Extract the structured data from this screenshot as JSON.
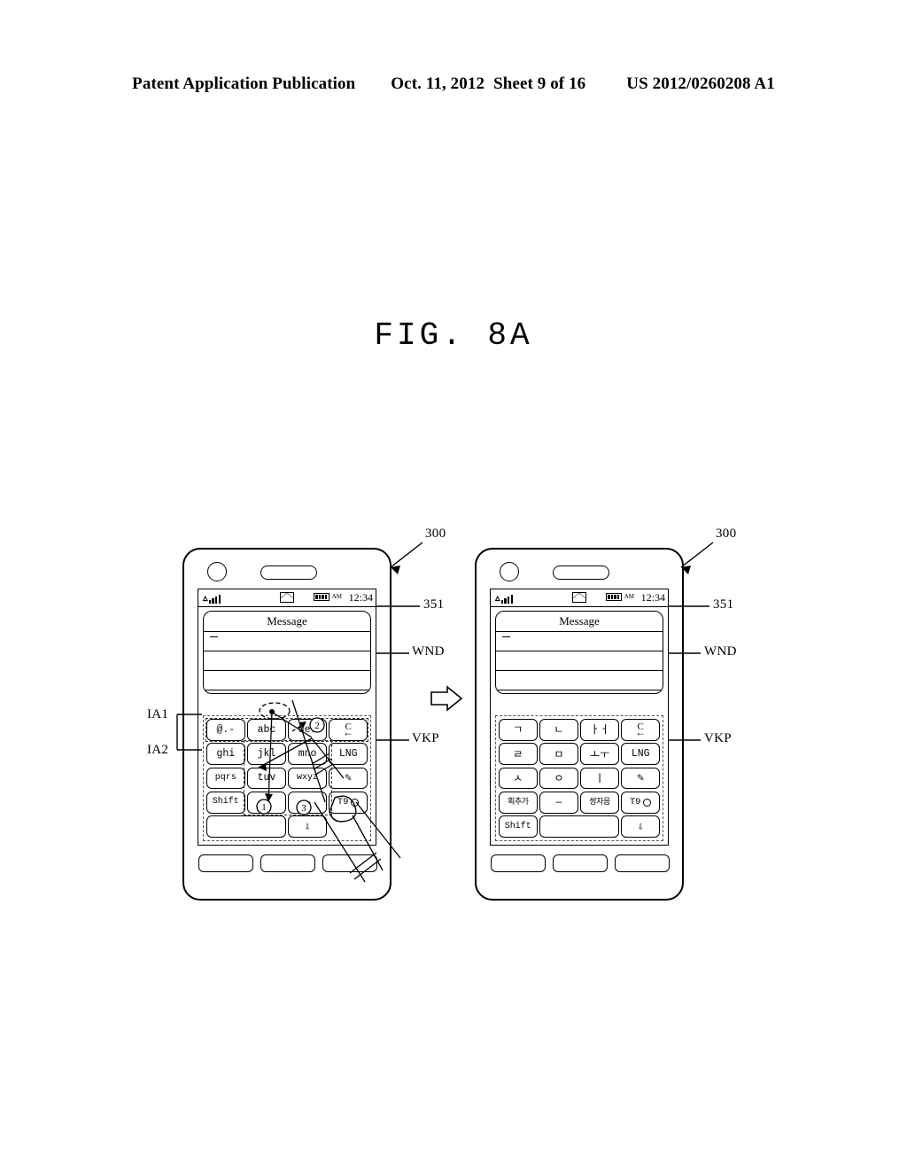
{
  "header": {
    "publication": "Patent Application Publication",
    "date": "Oct. 11, 2012",
    "sheet": "Sheet 9 of 16",
    "number": "US 2012/0260208 A1"
  },
  "figure": {
    "title": "FIG.  8A"
  },
  "status_bar": {
    "signal_icon": "signal-bars-icon",
    "message_icon": "envelope-icon",
    "battery_icon": "battery-icon",
    "ampm": "AM",
    "time": "12:34"
  },
  "message_window": {
    "title": "Message",
    "body_marker": "-"
  },
  "phones": {
    "left": {
      "keypad_mode": "latin",
      "keys": [
        {
          "label": "@.-",
          "name": "key-symbols"
        },
        {
          "label": "abc",
          "name": "key-abc"
        },
        {
          "label": "def",
          "name": "key-def"
        },
        {
          "label": "C",
          "name": "key-clear",
          "icon": "clear-backspace-icon"
        },
        {
          "label": "ghi",
          "name": "key-ghi"
        },
        {
          "label": "jkl",
          "name": "key-jkl"
        },
        {
          "label": "mno",
          "name": "key-mno"
        },
        {
          "label": "LNG",
          "name": "key-language"
        },
        {
          "label": "pqrs",
          "name": "key-pqrs"
        },
        {
          "label": "tuv",
          "name": "key-tuv"
        },
        {
          "label": "wxyz",
          "name": "key-wxyz"
        },
        {
          "label": "",
          "name": "key-handwriting",
          "icon": "pencil-icon"
        },
        {
          "label": "Shift",
          "name": "key-shift"
        },
        {
          "label": "",
          "name": "key-asterisk"
        },
        {
          "label": "—",
          "name": "key-dash"
        },
        {
          "label": "T9",
          "name": "key-t9",
          "icon": "t9-toggle-icon"
        },
        {
          "label": "",
          "name": "key-space",
          "wide": true
        },
        {
          "label": "",
          "name": "key-enter",
          "icon": "enter-download-icon"
        }
      ]
    },
    "right": {
      "keypad_mode": "korean",
      "keys": [
        {
          "label": "ㄱ",
          "name": "key-giyeok"
        },
        {
          "label": "ㄴ",
          "name": "key-nieun"
        },
        {
          "label": "ㅏㅓ",
          "name": "key-a-eo"
        },
        {
          "label": "C",
          "name": "key-clear",
          "icon": "clear-backspace-icon"
        },
        {
          "label": "ㄹ",
          "name": "key-rieul"
        },
        {
          "label": "ㅁ",
          "name": "key-mieum"
        },
        {
          "label": "ㅗㅜ",
          "name": "key-o-u"
        },
        {
          "label": "LNG",
          "name": "key-language"
        },
        {
          "label": "ㅅ",
          "name": "key-siot"
        },
        {
          "label": "ㅇ",
          "name": "key-ieung"
        },
        {
          "label": "ㅣ",
          "name": "key-i"
        },
        {
          "label": "",
          "name": "key-handwriting",
          "icon": "pencil-icon"
        },
        {
          "label": "획추가",
          "name": "key-add-stroke"
        },
        {
          "label": "—",
          "name": "key-dash"
        },
        {
          "label": "쌍자음",
          "name": "key-double-consonant"
        },
        {
          "label": "T9",
          "name": "key-t9",
          "icon": "t9-toggle-icon"
        },
        {
          "label": "Shift",
          "name": "key-shift"
        },
        {
          "label": "",
          "name": "key-space",
          "wide": true
        },
        {
          "label": "",
          "name": "key-enter",
          "icon": "enter-download-icon"
        }
      ]
    }
  },
  "reference_labels": {
    "device_left": "300",
    "device_right": "300",
    "display_left": "351",
    "display_right": "351",
    "window_left": "WND",
    "window_right": "WND",
    "keypad_left": "VKP",
    "keypad_right": "VKP",
    "input_area_1": "IA1",
    "input_area_2": "IA2"
  },
  "gesture_markers": {
    "step_1": "1",
    "step_2": "2",
    "step_3": "3"
  },
  "transition_arrow": "right-arrow-icon"
}
